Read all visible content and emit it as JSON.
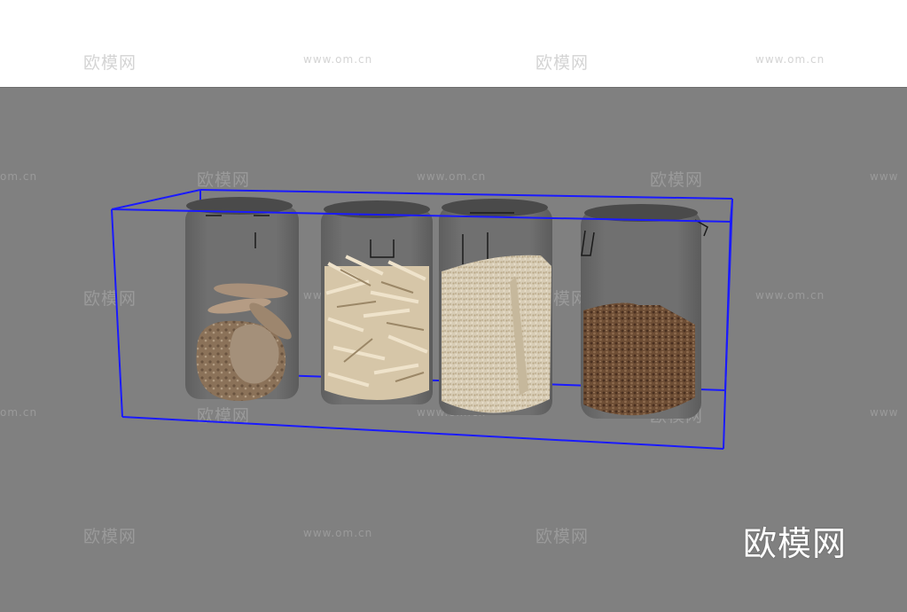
{
  "watermark": {
    "brand": "欧模网",
    "url": "www.om.cn",
    "url_partial": "om.cn",
    "url_partial_left": "www"
  },
  "scene": {
    "object_count": 4,
    "jar_contents": [
      "cookies",
      "pasta-sticks",
      "rice",
      "coffee-beans"
    ],
    "colors": {
      "background": "#808080",
      "top_band": "#ffffff",
      "bounding_box": "#1a1aff",
      "glass": "#6b6b6b"
    }
  }
}
